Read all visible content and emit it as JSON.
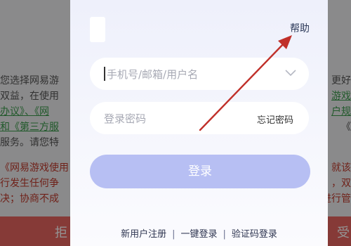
{
  "background": {
    "left_lines": [
      "您选择网易游",
      "双益，在使用",
      "办议》、《网",
      "和《第三方服",
      "服务。请您特",
      "《网易游戏使用",
      "行发生任何争",
      "决；协商不成"
    ],
    "right_lines": [
      "更好",
      "游戏",
      "户规",
      "《",
      "就该",
      "，双",
      "进行管"
    ],
    "bottom_left": "拒",
    "bottom_right": "受"
  },
  "login": {
    "help_label": "帮助",
    "account_placeholder": "手机号/邮箱/用户名",
    "password_placeholder": "登录密码",
    "forgot_label": "忘记密码",
    "login_label": "登录",
    "links": [
      "新用户注册",
      "一键登录",
      "验证码登录"
    ],
    "separator": "|"
  },
  "colors": {
    "accent_button": "#b7bff3",
    "arrow": "#c0302a"
  },
  "icons": {
    "dropdown": "chevron-down-icon",
    "annotation": "arrow-icon"
  }
}
